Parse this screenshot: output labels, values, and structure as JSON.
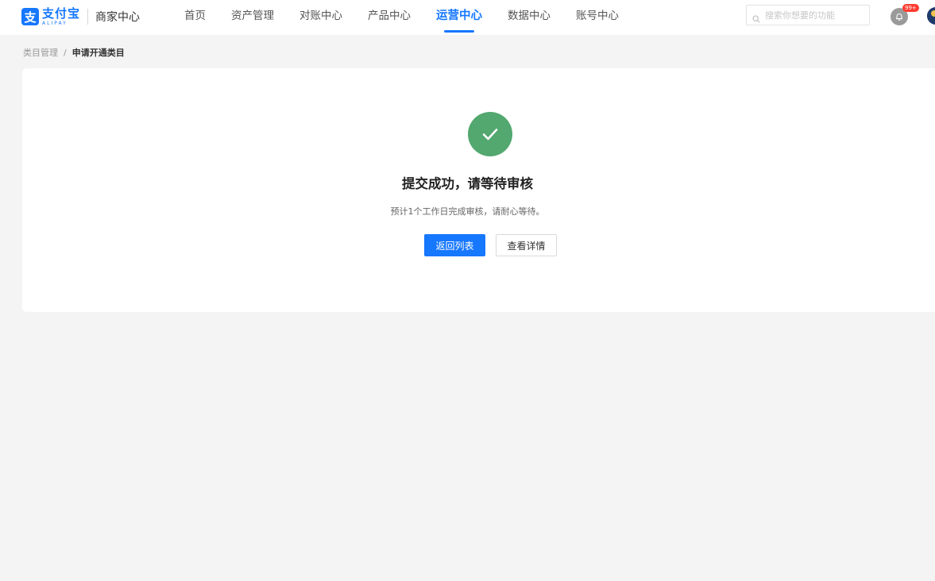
{
  "header": {
    "logo": {
      "brand_cn": "支付宝",
      "brand_en": "ALIPAY",
      "product": "商家中心",
      "mark": "支"
    },
    "nav": [
      {
        "label": "首页",
        "active": false
      },
      {
        "label": "资产管理",
        "active": false
      },
      {
        "label": "对账中心",
        "active": false
      },
      {
        "label": "产品中心",
        "active": false
      },
      {
        "label": "运营中心",
        "active": true
      },
      {
        "label": "数据中心",
        "active": false
      },
      {
        "label": "账号中心",
        "active": false
      }
    ],
    "search": {
      "placeholder": "搜索你想要的功能",
      "icon": "search-icon"
    },
    "notifications": {
      "badge": "99+",
      "icon": "bell-icon"
    }
  },
  "breadcrumb": {
    "parent": "类目管理",
    "separator": "/",
    "current": "申请开通类目"
  },
  "result": {
    "status": "success",
    "icon": "check-circle-icon",
    "icon_color": "#52a86f",
    "title": "提交成功，请等待审核",
    "description": "预计1个工作日完成审核，请耐心等待。",
    "primary_button": "返回列表",
    "secondary_button": "查看详情"
  },
  "colors": {
    "accent": "#1677ff",
    "background": "#f4f4f4",
    "badge": "#ff3b30"
  }
}
